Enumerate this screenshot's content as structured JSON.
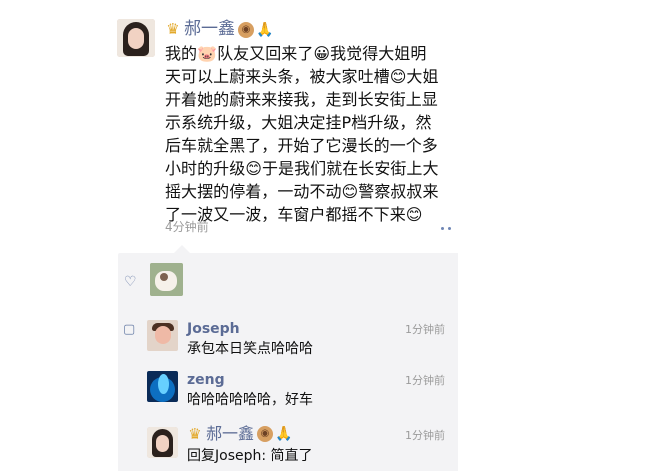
{
  "post": {
    "author": "郝一鑫",
    "name_badges": [
      "crown-icon",
      "monkey-face-icon",
      "pray-icon"
    ],
    "content_lines": [
      "我的🐷队友又回来了😀我觉得大姐明",
      "天可以上蔚来头条，被大家吐槽😊大姐",
      "开着她的蔚来来接我，走到长安街上显",
      "示系统升级，大姐决定挂P档升级，然",
      "后车就全黑了，开始了它漫长的一个多",
      "小时的升级😊于是我们就在长安街上大",
      "摇大摆的停着，一动不动😊警察叔叔来",
      "了一波又一波，车窗户都摇不下来😊"
    ],
    "time": "4分钟前"
  },
  "comments": [
    {
      "name": "Joseph",
      "text": "承包本日笑点哈哈哈",
      "time": "1分钟前"
    },
    {
      "name": "zeng",
      "text": "哈哈哈哈哈哈，好车",
      "time": "1分钟前"
    },
    {
      "name": "郝一鑫",
      "text": "回复Joseph: 简直了",
      "time": "1分钟前"
    }
  ],
  "icons": {
    "like": "heart-icon",
    "comment": "comment-icon",
    "menu": "more-options-icon"
  },
  "colors": {
    "name": "#5b6b95",
    "text": "#111111",
    "time": "#9b9b9b",
    "panel": "#f3f3f5"
  }
}
